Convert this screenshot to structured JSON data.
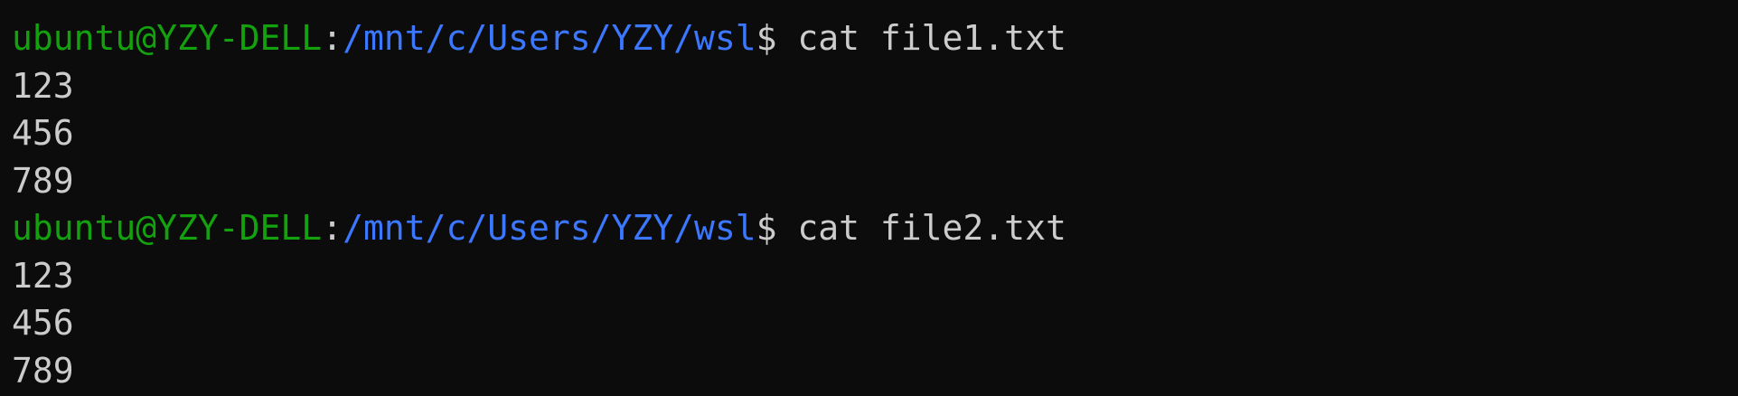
{
  "terminal": {
    "colors": {
      "background": "#0c0c0c",
      "user": "#13a10e",
      "path": "#3b78ff",
      "text": "#cccccc"
    },
    "prompt1": {
      "user": "ubuntu@YZY-DELL",
      "sep": ":",
      "path": "/mnt/c/Users/YZY/wsl",
      "dollar": "$",
      "command": "cat file1.txt"
    },
    "output1": [
      "123",
      "456",
      "789"
    ],
    "prompt2": {
      "user": "ubuntu@YZY-DELL",
      "sep": ":",
      "path": "/mnt/c/Users/YZY/wsl",
      "dollar": "$",
      "command": "cat file2.txt"
    },
    "output2": [
      "123",
      "456",
      "789"
    ]
  }
}
